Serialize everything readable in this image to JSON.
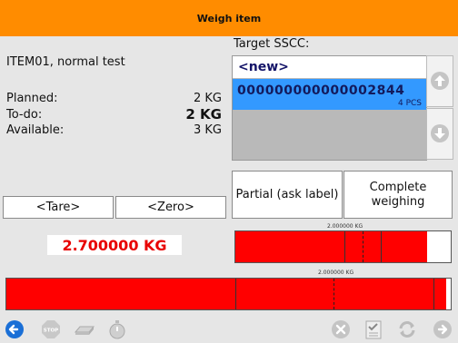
{
  "header": {
    "title": "Weigh item"
  },
  "item": {
    "name": "ITEM01, normal test"
  },
  "quantities": {
    "planned_label": "Planned:",
    "planned_value": "2 KG",
    "todo_label": "To-do:",
    "todo_value": "2 KG",
    "available_label": "Available:",
    "available_value": "3 KG"
  },
  "sscc": {
    "title": "Target SSCC:",
    "items": [
      {
        "code": "<new>"
      },
      {
        "code": "000000000000002844",
        "qty": "4 PCS",
        "selected": true
      }
    ]
  },
  "buttons": {
    "partial": "Partial (ask label)",
    "complete": "Complete weighing",
    "tare": "<Tare>",
    "zero": "<Zero>"
  },
  "weight": {
    "current": "2.700000 KG",
    "target_label": "2.000000 KG",
    "target_label_bottom": "2.000000 KG",
    "small_bar_fill_fraction": 0.89,
    "large_bar_fill_fraction": 0.99
  },
  "toolbar": {
    "icons": [
      "back-arrow-icon",
      "stop-icon",
      "scale-icon",
      "stopwatch-icon",
      "cancel-icon",
      "checklist-icon",
      "refresh-icon",
      "forward-arrow-icon"
    ]
  },
  "colors": {
    "header": "#ff8c00",
    "selected_row": "#3399ff",
    "bar_fill": "#ff0000",
    "weight_text": "#e80000"
  }
}
